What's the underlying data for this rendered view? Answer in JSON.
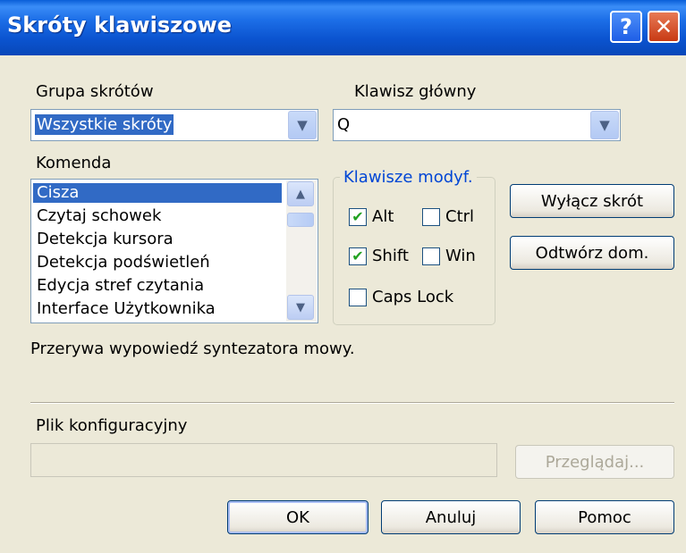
{
  "window": {
    "title": "Skróty klawiszowe",
    "help_glyph": "?",
    "close_glyph": "✕"
  },
  "group_label": "Grupa skrótów",
  "group_select": {
    "value": "Wszystkie skróty"
  },
  "key_label": "Klawisz główny",
  "key_select": {
    "value": "Q"
  },
  "command_label": "Komenda",
  "commands": [
    "Cisza",
    "Czytaj schowek",
    "Detekcja kursora",
    "Detekcja podświetleń",
    "Edycja stref czytania",
    "Interface Użytkownika"
  ],
  "selected_command_index": 0,
  "modifiers": {
    "title": "Klawisze modyf.",
    "alt": {
      "label": "Alt",
      "checked": true
    },
    "ctrl": {
      "label": "Ctrl",
      "checked": false
    },
    "shift": {
      "label": "Shift",
      "checked": true
    },
    "win": {
      "label": "Win",
      "checked": false
    },
    "capslock": {
      "label": "Caps Lock",
      "checked": false
    }
  },
  "buttons": {
    "disable": "Wyłącz skrót",
    "restore": "Odtwórz dom.",
    "browse": "Przeglądaj...",
    "ok": "OK",
    "cancel": "Anuluj",
    "help": "Pomoc"
  },
  "description": "Przerywa wypowiedź syntezatora mowy.",
  "config_label": "Plik konfiguracyjny",
  "config_value": ""
}
